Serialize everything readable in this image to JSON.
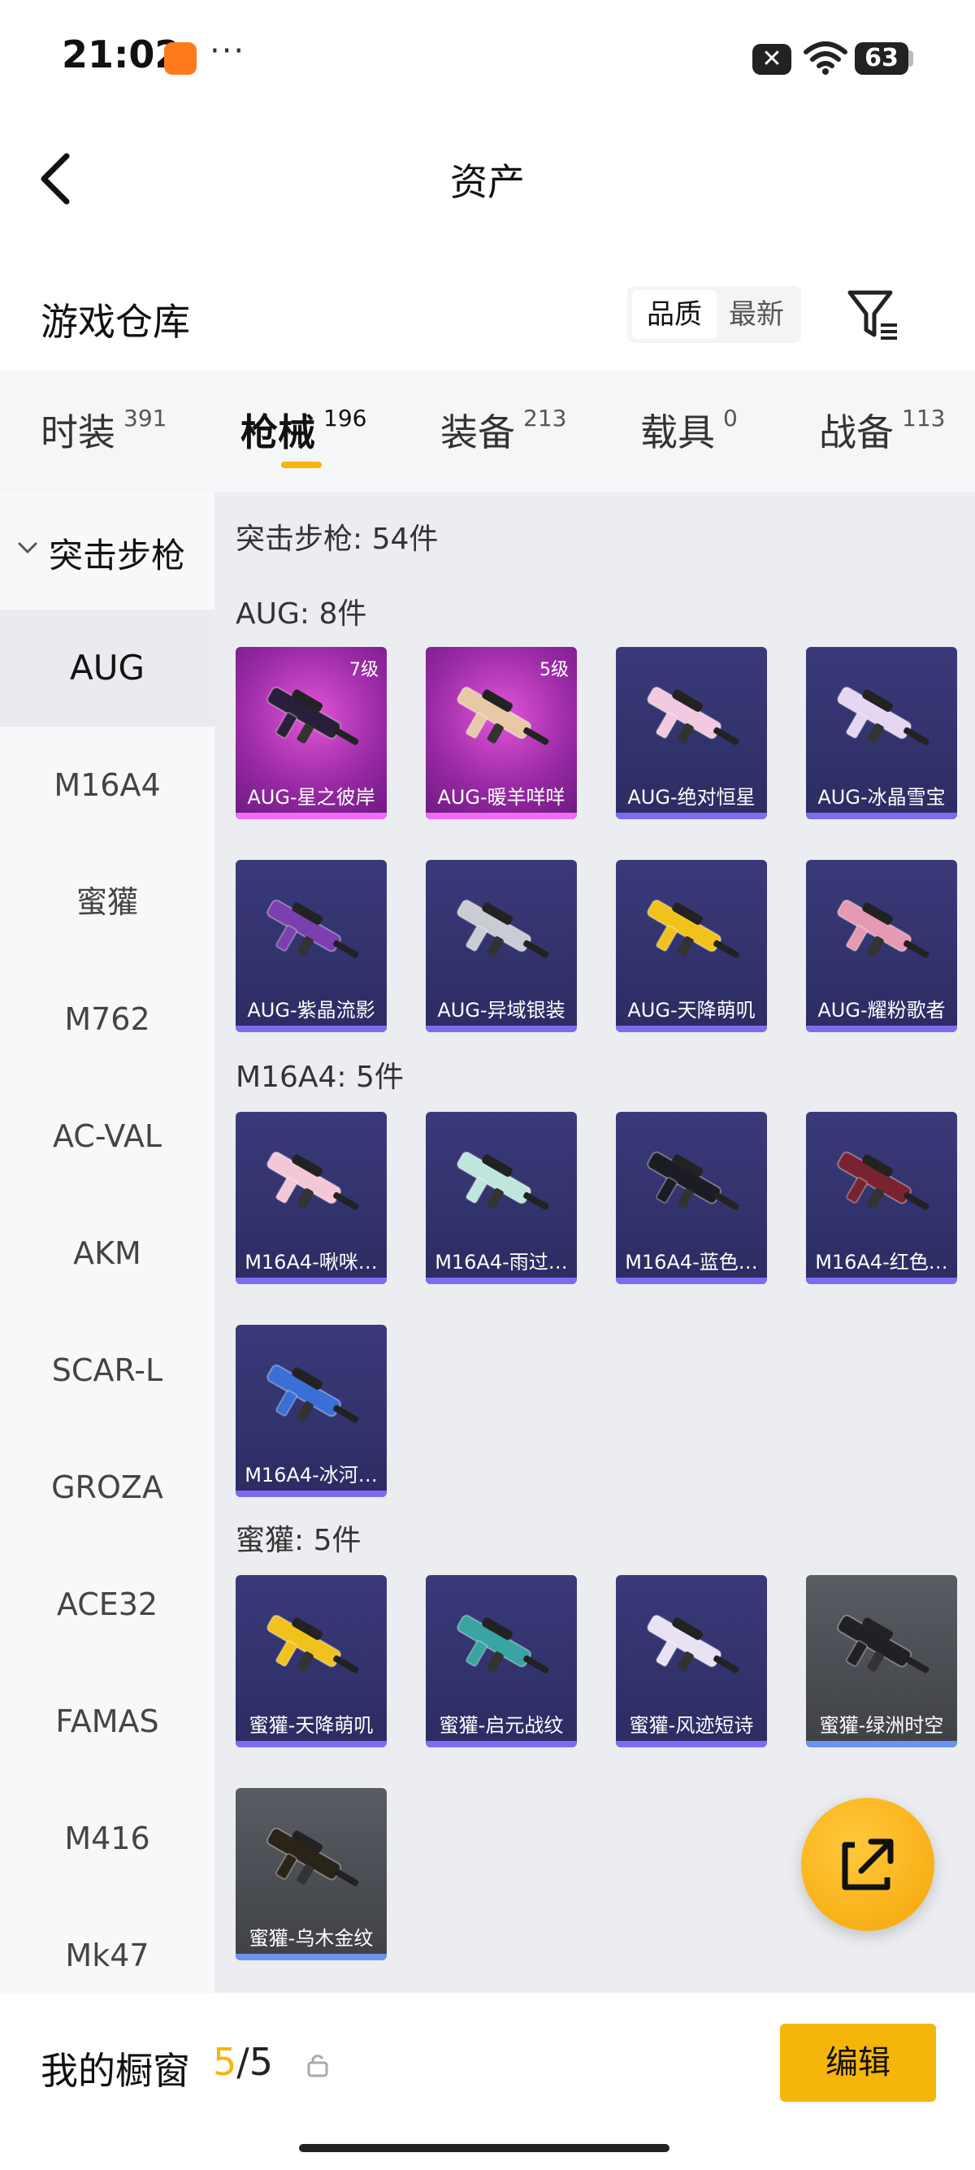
{
  "status_bar": {
    "time": "21:02",
    "dots": "···",
    "battery": "63"
  },
  "header": {
    "title": "资产"
  },
  "warehouse": {
    "title": "游戏仓库",
    "sort_options": [
      "品质",
      "最新"
    ]
  },
  "tabs": [
    {
      "label": "时装",
      "count": "391"
    },
    {
      "label": "枪械",
      "count": "196",
      "active": true
    },
    {
      "label": "装备",
      "count": "213"
    },
    {
      "label": "载具",
      "count": "0"
    },
    {
      "label": "战备",
      "count": "113"
    }
  ],
  "sidebar": {
    "category": "突击步枪",
    "items": [
      "AUG",
      "M16A4",
      "蜜獾",
      "M762",
      "AC-VAL",
      "AKM",
      "SCAR-L",
      "GROZA",
      "ACE32",
      "FAMAS",
      "M416",
      "Mk47"
    ],
    "active_index": 0
  },
  "main": {
    "summary": "突击步枪: 54件",
    "sections": [
      {
        "heading": "AUG: 8件",
        "items": [
          {
            "name": "AUG-星之彼岸",
            "level": "7级",
            "rarity": "rare",
            "gun_color": "#2a1f3a"
          },
          {
            "name": "AUG-暖羊咩咩",
            "level": "5级",
            "rarity": "rare",
            "gun_color": "#e8c9a6"
          },
          {
            "name": "AUG-绝对恒星",
            "level": "",
            "rarity": "epic",
            "gun_color": "#f2c9df"
          },
          {
            "name": "AUG-冰晶雪宝",
            "level": "",
            "rarity": "epic",
            "gun_color": "#e6d6f2"
          },
          {
            "name": "AUG-紫晶流影",
            "level": "",
            "rarity": "epic",
            "gun_color": "#7c3fb0"
          },
          {
            "name": "AUG-异域银装",
            "level": "",
            "rarity": "epic",
            "gun_color": "#c9ccd2"
          },
          {
            "name": "AUG-天降萌叽",
            "level": "",
            "rarity": "epic",
            "gun_color": "#f2c21c"
          },
          {
            "name": "AUG-耀粉歌者",
            "level": "",
            "rarity": "epic",
            "gun_color": "#e59ab2"
          }
        ]
      },
      {
        "heading": "M16A4: 5件",
        "items": [
          {
            "name": "M16A4-啾咪…",
            "level": "",
            "rarity": "epic",
            "gun_color": "#f4c7d6"
          },
          {
            "name": "M16A4-雨过…",
            "level": "",
            "rarity": "epic",
            "gun_color": "#bfe6dc"
          },
          {
            "name": "M16A4-蓝色…",
            "level": "",
            "rarity": "epic",
            "gun_color": "#1c1c24"
          },
          {
            "name": "M16A4-红色…",
            "level": "",
            "rarity": "epic",
            "gun_color": "#7a2330"
          },
          {
            "name": "M16A4-冰河…",
            "level": "",
            "rarity": "epic",
            "gun_color": "#3a6fd8"
          }
        ]
      },
      {
        "heading": "蜜獾: 5件",
        "items": [
          {
            "name": "蜜獾-天降萌叽",
            "level": "",
            "rarity": "epic",
            "gun_color": "#f2c21c"
          },
          {
            "name": "蜜獾-启元战纹",
            "level": "",
            "rarity": "epic",
            "gun_color": "#3aa3a3"
          },
          {
            "name": "蜜獾-风迹短诗",
            "level": "",
            "rarity": "epic",
            "gun_color": "#e8e2f4"
          },
          {
            "name": "蜜獾-绿洲时空",
            "level": "",
            "rarity": "grey",
            "gun_color": "#1f2126"
          },
          {
            "name": "蜜獾-乌木金纹",
            "level": "",
            "rarity": "grey",
            "gun_color": "#2a2418"
          }
        ]
      }
    ]
  },
  "bottom_bar": {
    "showcase_label": "我的橱窗",
    "showcase_current": "5",
    "showcase_total": "/5",
    "edit_label": "编辑"
  },
  "colors": {
    "accent": "#f5b50a",
    "rare_card": "#c33cc8",
    "epic_card": "#34346e",
    "grey_card": "#4a4c52"
  }
}
